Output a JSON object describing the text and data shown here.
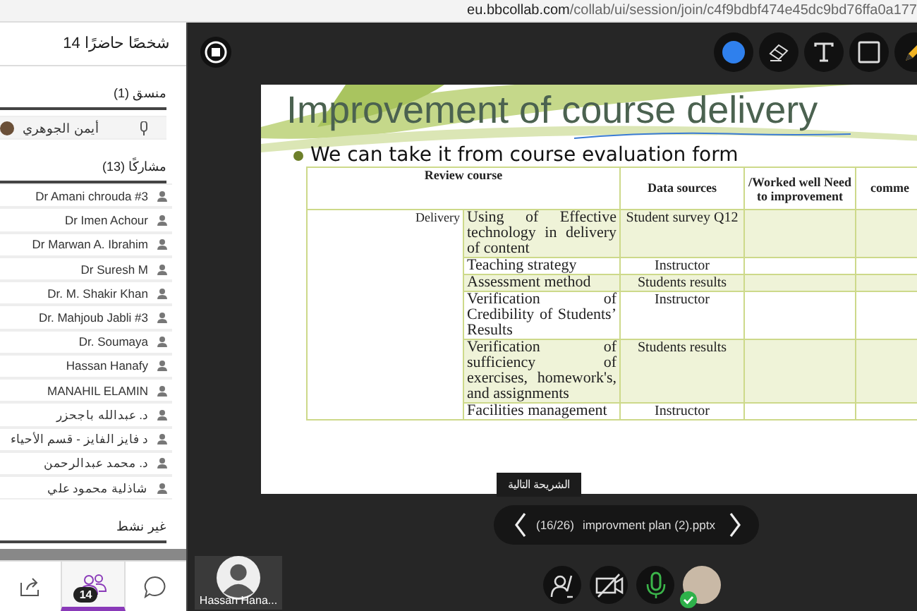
{
  "browser": {
    "url_host": "eu.bbcollab.com",
    "url_path": "/collab/ui/session/join/c4f9bdbf474e45dc9bd76ffa0a177"
  },
  "sidebar": {
    "title": "14 شخصًا حاضرًا",
    "sections": [
      {
        "title": "منسق (1)",
        "kind": "moderators",
        "people": [
          {
            "name": "أيمن الجوهري",
            "mic": true
          }
        ]
      },
      {
        "title": "مشاركًا (13)",
        "kind": "participants",
        "people": [
          {
            "name": "Dr Amani chrouda #3"
          },
          {
            "name": "Dr Imen Achour"
          },
          {
            "name": "Dr Marwan A. Ibrahim"
          },
          {
            "name": "Dr Suresh M"
          },
          {
            "name": "Dr. M. Shakir Khan"
          },
          {
            "name": "Dr. Mahjoub Jabli #3"
          },
          {
            "name": "Dr. Soumaya"
          },
          {
            "name": "Hassan Hanafy"
          },
          {
            "name": "MANAHIL ELAMIN"
          },
          {
            "name": "د. عبدالله باجحزر"
          },
          {
            "name": "د فايز الفايز - قسم الأحياء"
          },
          {
            "name": "د. محمد عبدالرحمن"
          },
          {
            "name": "شاذلية محمود علي"
          }
        ]
      },
      {
        "title": "غير نشط",
        "kind": "inactive"
      }
    ],
    "tabs": [
      {
        "kind": "share",
        "selected": false
      },
      {
        "kind": "participants",
        "selected": true,
        "badge": "14"
      },
      {
        "kind": "chat",
        "selected": false
      }
    ]
  },
  "toolbar": {
    "tools": [
      {
        "kind": "color"
      },
      {
        "kind": "eraser"
      },
      {
        "kind": "text"
      },
      {
        "kind": "shape"
      },
      {
        "kind": "pencil"
      }
    ]
  },
  "slide": {
    "title": "Improvement of course delivery",
    "bullet": "We can take it from course evaluation form",
    "table": {
      "columns": [
        "Review course",
        "Data sources",
        "/Worked well Need to improvement",
        "comme"
      ],
      "group": "Delivery",
      "rows": [
        {
          "item": "Using of Effective technology in delivery of content",
          "source": "Student survey Q12"
        },
        {
          "item": "Teaching strategy",
          "source": "Instructor"
        },
        {
          "item": "Assessment method",
          "source": "Students results"
        },
        {
          "item": "Verification of Credibility of Students’ Results",
          "source": "Instructor"
        },
        {
          "item": "Verification of sufficiency of exercises, homework's, and assignments",
          "source": "Students results"
        },
        {
          "item": "Facilities management",
          "source": "Instructor"
        }
      ]
    }
  },
  "tooltip": "الشريحة التالية",
  "navigator": {
    "counter": "(16/26)",
    "file": "improvment plan (2).pptx"
  },
  "video_tile": {
    "name": "Hassan Hana..."
  },
  "controls": [
    {
      "kind": "hand"
    },
    {
      "kind": "camera",
      "on": false
    },
    {
      "kind": "microphone",
      "on": true
    }
  ],
  "me": {
    "connected": true
  }
}
